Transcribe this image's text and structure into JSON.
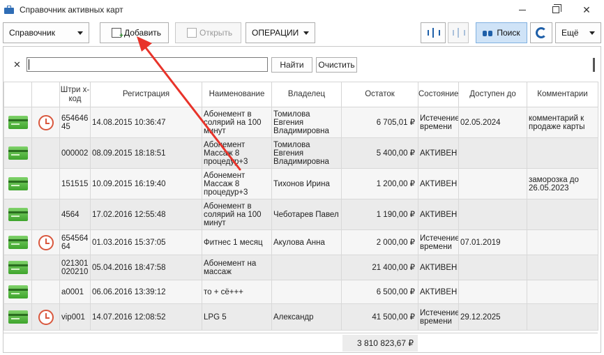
{
  "window": {
    "title": "Справочник активных карт"
  },
  "toolbar": {
    "directory_label": "Справочник",
    "add_label": "Добавить",
    "open_label": "Открыть",
    "operations_label": "ОПЕРАЦИИ",
    "search_label": "Поиск",
    "more_label": "Ещё"
  },
  "filter": {
    "query": "",
    "find_label": "Найти",
    "clear_label": "Очистить"
  },
  "columns": [
    "Штри х-код",
    "Регистрация",
    "Наименование",
    "Владелец",
    "Остаток",
    "Состояние",
    "Доступен до",
    "Комментарии"
  ],
  "rows": [
    {
      "clock": true,
      "barcode": "654646 45",
      "registered": "14.08.2015 10:36:47",
      "name": "Абонемент в солярий на 100 минут",
      "owner": "Томилова Евгения Владимировна",
      "balance": "6 705,01 ₽",
      "status": "Истечение времени",
      "available_until": "02.05.2024",
      "comment": "комментарий к продаже карты"
    },
    {
      "clock": false,
      "barcode": "000002",
      "registered": "08.09.2015 18:18:51",
      "name": "Абонемент Массаж 8 процедур+3",
      "owner": "Томилова Евгения Владимировна",
      "balance": "5 400,00 ₽",
      "status": "АКТИВЕН",
      "available_until": "",
      "comment": ""
    },
    {
      "clock": false,
      "barcode": "151515",
      "registered": "10.09.2015 16:19:40",
      "name": "Абонемент Массаж 8 процедур+3",
      "owner": "Тихонов Ирина",
      "balance": "1 200,00 ₽",
      "status": "АКТИВЕН",
      "available_until": "",
      "comment": "заморозка до 26.05.2023"
    },
    {
      "clock": false,
      "barcode": "4564",
      "registered": "17.02.2016 12:55:48",
      "name": "Абонемент в солярий на 100 минут",
      "owner": "Чеботарев Павел",
      "balance": "1 190,00 ₽",
      "status": "АКТИВЕН",
      "available_until": "",
      "comment": ""
    },
    {
      "clock": true,
      "barcode": "654564 64",
      "registered": "01.03.2016 15:37:05",
      "name": "Фитнес 1 месяц",
      "owner": "Акулова Анна",
      "balance": "2 000,00 ₽",
      "status": "Истечение времени",
      "available_until": "07.01.2019",
      "comment": ""
    },
    {
      "clock": false,
      "barcode": "021301 020210",
      "registered": "05.04.2016 18:47:58",
      "name": "Абонемент на массаж",
      "owner": "",
      "balance": "21 400,00 ₽",
      "status": "АКТИВЕН",
      "available_until": "",
      "comment": ""
    },
    {
      "clock": false,
      "barcode": "a0001",
      "registered": "06.06.2016 13:39:12",
      "name": "то + сё+++",
      "owner": "",
      "balance": "6 500,00 ₽",
      "status": "АКТИВЕН",
      "available_until": "",
      "comment": ""
    },
    {
      "clock": true,
      "barcode": "vip001",
      "registered": "14.07.2016 12:08:52",
      "name": "LPG 5",
      "owner": "Александр",
      "balance": "41 500,00 ₽",
      "status": "Истечение времени",
      "available_until": "29.12.2025",
      "comment": ""
    }
  ],
  "footer": {
    "total": "3 810 823,67 ₽"
  },
  "colors": {
    "annotation_arrow": "#e8332a",
    "card_green": "#3ea42c",
    "clock_red": "#d9573d",
    "search_active": "#cfe3f7"
  },
  "icons": [
    "briefcase-icon",
    "card-icon",
    "clock-icon",
    "binoculars-icon",
    "refresh-icon",
    "split-view-icon"
  ]
}
